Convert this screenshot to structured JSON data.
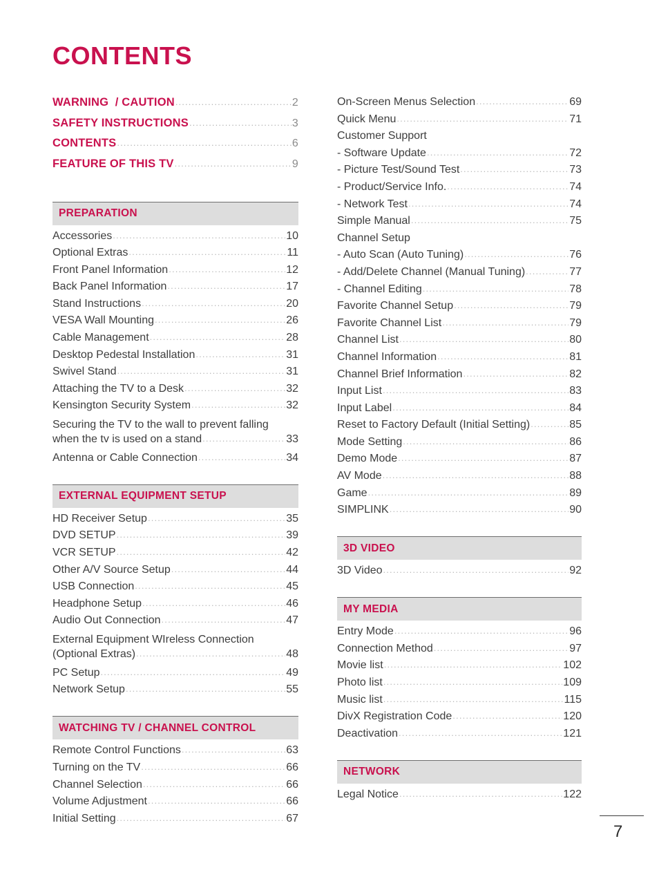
{
  "title": "CONTENTS",
  "footer": {
    "page_number": "7"
  },
  "colors": {
    "accent": "#c9114e",
    "section_bar_bg": "#dddddd",
    "section_bar_rule": "#6d6d6d",
    "body_text": "#3d3d3d",
    "leader_dots": "#b8b8b8"
  },
  "left_column": {
    "front_matter": [
      {
        "label": "WARNING  / CAUTION",
        "page": "2"
      },
      {
        "label": "SAFETY INSTRUCTIONS",
        "page": "3"
      },
      {
        "label": "CONTENTS",
        "page": "6"
      },
      {
        "label": "FEATURE OF THIS TV",
        "page": "9"
      }
    ],
    "sections": [
      {
        "title": "PREPARATION",
        "entries": [
          {
            "label": "Accessories",
            "page": "10"
          },
          {
            "label": "Optional Extras",
            "page": "11"
          },
          {
            "label": "Front Panel Information",
            "page": "12"
          },
          {
            "label": "Back Panel Information",
            "page": "17"
          },
          {
            "label": "Stand Instructions",
            "page": "20"
          },
          {
            "label": "VESA Wall Mounting",
            "page": "26"
          },
          {
            "label": "Cable Management",
            "page": "28"
          },
          {
            "label": "Desktop Pedestal Installation",
            "page": "31"
          },
          {
            "label": "Swivel Stand",
            "page": "31"
          },
          {
            "label": "Attaching the TV to a Desk",
            "page": "32"
          },
          {
            "label": "Kensington Security System",
            "page": "32"
          },
          {
            "label": "Securing the TV to the wall to prevent falling",
            "label2": "when the tv is used on a stand",
            "page": "33",
            "wrap": true
          },
          {
            "label": "Antenna or Cable Connection",
            "page": "34"
          }
        ]
      },
      {
        "title": "EXTERNAL EQUIPMENT SETUP",
        "entries": [
          {
            "label": "HD Receiver Setup",
            "page": "35"
          },
          {
            "label": "DVD SETUP",
            "page": "39"
          },
          {
            "label": "VCR SETUP",
            "page": "42"
          },
          {
            "label": "Other A/V Source Setup",
            "page": "44"
          },
          {
            "label": "USB Connection",
            "page": "45"
          },
          {
            "label": "Headphone Setup",
            "page": "46"
          },
          {
            "label": "Audio Out Connection",
            "page": "47"
          },
          {
            "label": "External Equipment WIreless Connection",
            "label2": "(Optional Extras)",
            "page": "48",
            "wrap": true
          },
          {
            "label": "PC Setup",
            "page": "49"
          },
          {
            "label": "Network Setup",
            "page": "55"
          }
        ]
      },
      {
        "title": "WATCHING TV / CHANNEL CONTROL",
        "entries": [
          {
            "label": "Remote Control Functions",
            "page": "63"
          },
          {
            "label": "Turning on the TV",
            "page": "66"
          },
          {
            "label": "Channel Selection",
            "page": "66"
          },
          {
            "label": "Volume Adjustment",
            "page": "66"
          },
          {
            "label": "Initial Setting",
            "page": "67"
          }
        ]
      }
    ]
  },
  "right_column": {
    "continued_entries": [
      {
        "label": "On-Screen Menus Selection",
        "page": "69"
      },
      {
        "label": "Quick Menu",
        "page": "71"
      },
      {
        "label": "Customer Support",
        "page": "",
        "nopage": true
      },
      {
        "label": "- Software Update",
        "page": "72"
      },
      {
        "label": "- Picture Test/Sound Test",
        "page": "73"
      },
      {
        "label": "- Product/Service Info.",
        "page": "74"
      },
      {
        "label": "- Network Test",
        "page": "74"
      },
      {
        "label": "Simple Manual",
        "page": "75"
      },
      {
        "label": "Channel Setup",
        "page": "",
        "nopage": true
      },
      {
        "label": "- Auto Scan (Auto Tuning)",
        "page": "76"
      },
      {
        "label": "- Add/Delete Channel (Manual Tuning)",
        "page": "77"
      },
      {
        "label": "- Channel Editing",
        "page": "78"
      },
      {
        "label": "Favorite Channel Setup",
        "page": "79"
      },
      {
        "label": "Favorite Channel List",
        "page": "79"
      },
      {
        "label": "Channel List",
        "page": "80"
      },
      {
        "label": "Channel Information",
        "page": "81"
      },
      {
        "label": "Channel Brief Information",
        "page": "82"
      },
      {
        "label": "Input List",
        "page": "83"
      },
      {
        "label": "Input Label",
        "page": "84"
      },
      {
        "label": "Reset to Factory Default (Initial Setting)",
        "page": "85"
      },
      {
        "label": "Mode Setting",
        "page": "86"
      },
      {
        "label": "Demo Mode",
        "page": "87"
      },
      {
        "label": "AV Mode",
        "page": "88"
      },
      {
        "label": "Game",
        "page": "89"
      },
      {
        "label": "SIMPLINK",
        "page": "90"
      }
    ],
    "sections": [
      {
        "title": "3D VIDEO",
        "entries": [
          {
            "label": "3D Video",
            "page": "92"
          }
        ]
      },
      {
        "title": "MY MEDIA",
        "entries": [
          {
            "label": "Entry Mode",
            "page": "96"
          },
          {
            "label": "Connection Method",
            "page": "97"
          },
          {
            "label": "Movie list",
            "page": "102"
          },
          {
            "label": "Photo list",
            "page": "109"
          },
          {
            "label": "Music list",
            "page": "115"
          },
          {
            "label": "DivX Registration Code",
            "page": "120"
          },
          {
            "label": "Deactivation",
            "page": "121"
          }
        ]
      },
      {
        "title": "NETWORK",
        "entries": [
          {
            "label": "Legal Notice",
            "page": "122"
          }
        ]
      }
    ]
  }
}
